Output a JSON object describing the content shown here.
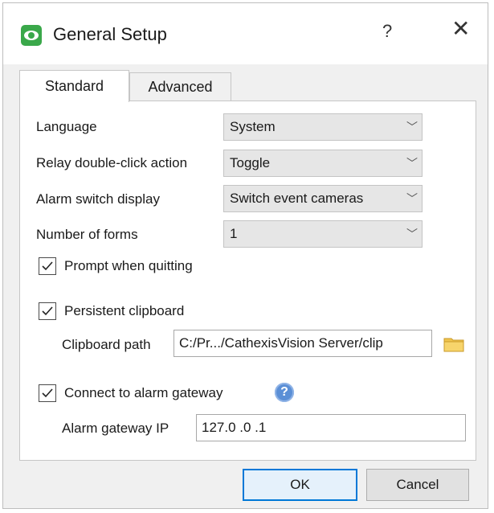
{
  "window": {
    "title": "General Setup",
    "help_label": "?",
    "close_label": "✕"
  },
  "tabs": [
    {
      "label": "Standard",
      "active": true
    },
    {
      "label": "Advanced",
      "active": false
    }
  ],
  "fields": {
    "language": {
      "label": "Language",
      "value": "System"
    },
    "relay_action": {
      "label": "Relay double-click action",
      "value": "Toggle"
    },
    "alarm_switch": {
      "label": "Alarm switch display",
      "value": "Switch event cameras"
    },
    "num_forms": {
      "label": "Number of forms",
      "value": "1"
    }
  },
  "checkboxes": {
    "prompt_quit": {
      "label": "Prompt when quitting",
      "checked": true
    },
    "persistent_clipboard": {
      "label": "Persistent clipboard",
      "checked": true
    },
    "alarm_gateway": {
      "label": "Connect to alarm gateway",
      "checked": true
    }
  },
  "clipboard": {
    "label": "Clipboard path",
    "value": "C:/Pr.../CathexisVision Server/clip"
  },
  "gateway": {
    "label": "Alarm gateway IP",
    "value": "127.0  .0  .1"
  },
  "info_glyph": "?",
  "buttons": {
    "ok": "OK",
    "cancel": "Cancel"
  },
  "icons": {
    "app": "eye-icon",
    "folder": "folder-icon",
    "info": "info-icon",
    "dropdown": "chevron-down-icon"
  },
  "colors": {
    "app_icon": "#3aa84a",
    "accent": "#0078d7",
    "info": "#5b8fd6",
    "folder": "#f0c44c"
  }
}
